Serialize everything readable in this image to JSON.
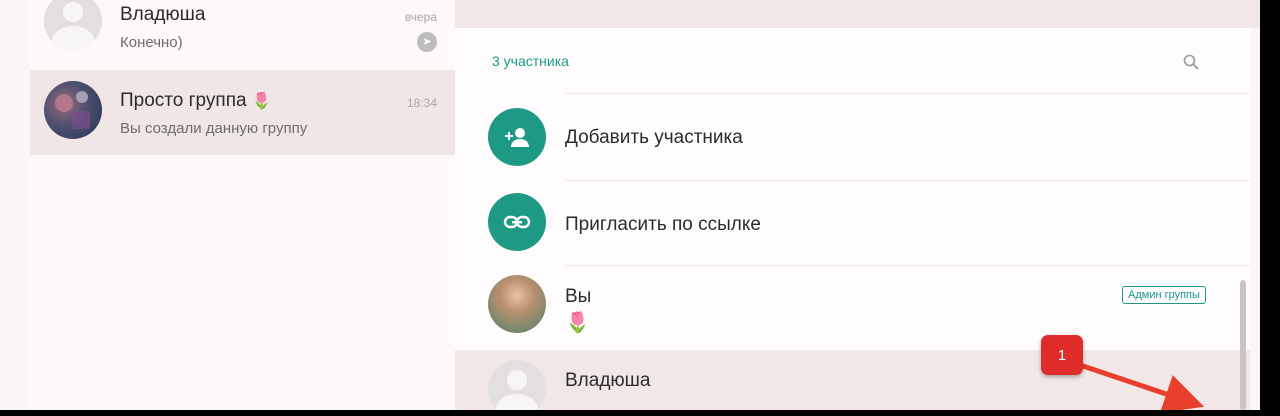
{
  "chat_list": [
    {
      "name": "Владюша",
      "subtitle": "Конечно)",
      "time": "вчера",
      "avatar": "default-avatar",
      "status_icon": "pin-icon"
    },
    {
      "name": "Просто группа",
      "name_emoji": "🌷",
      "subtitle": "Вы создали данную группу",
      "time": "18:34",
      "avatar": "group-photo"
    }
  ],
  "group_info": {
    "participants_count": "3 участника",
    "actions": [
      {
        "label": "Добавить участника",
        "icon": "add-person-icon"
      },
      {
        "label": "Пригласить по ссылке",
        "icon": "link-icon"
      }
    ],
    "members": [
      {
        "name": "Вы",
        "status": "🌷",
        "badge": "Админ группы",
        "avatar": "user-photo"
      },
      {
        "name": "Владюша",
        "avatar": "default-avatar"
      }
    ]
  },
  "annotation": {
    "marker_label": "1"
  },
  "colors": {
    "accent": "#1e9a84",
    "marker": "#e02b2b",
    "selected_row": "#f1e6e6"
  }
}
